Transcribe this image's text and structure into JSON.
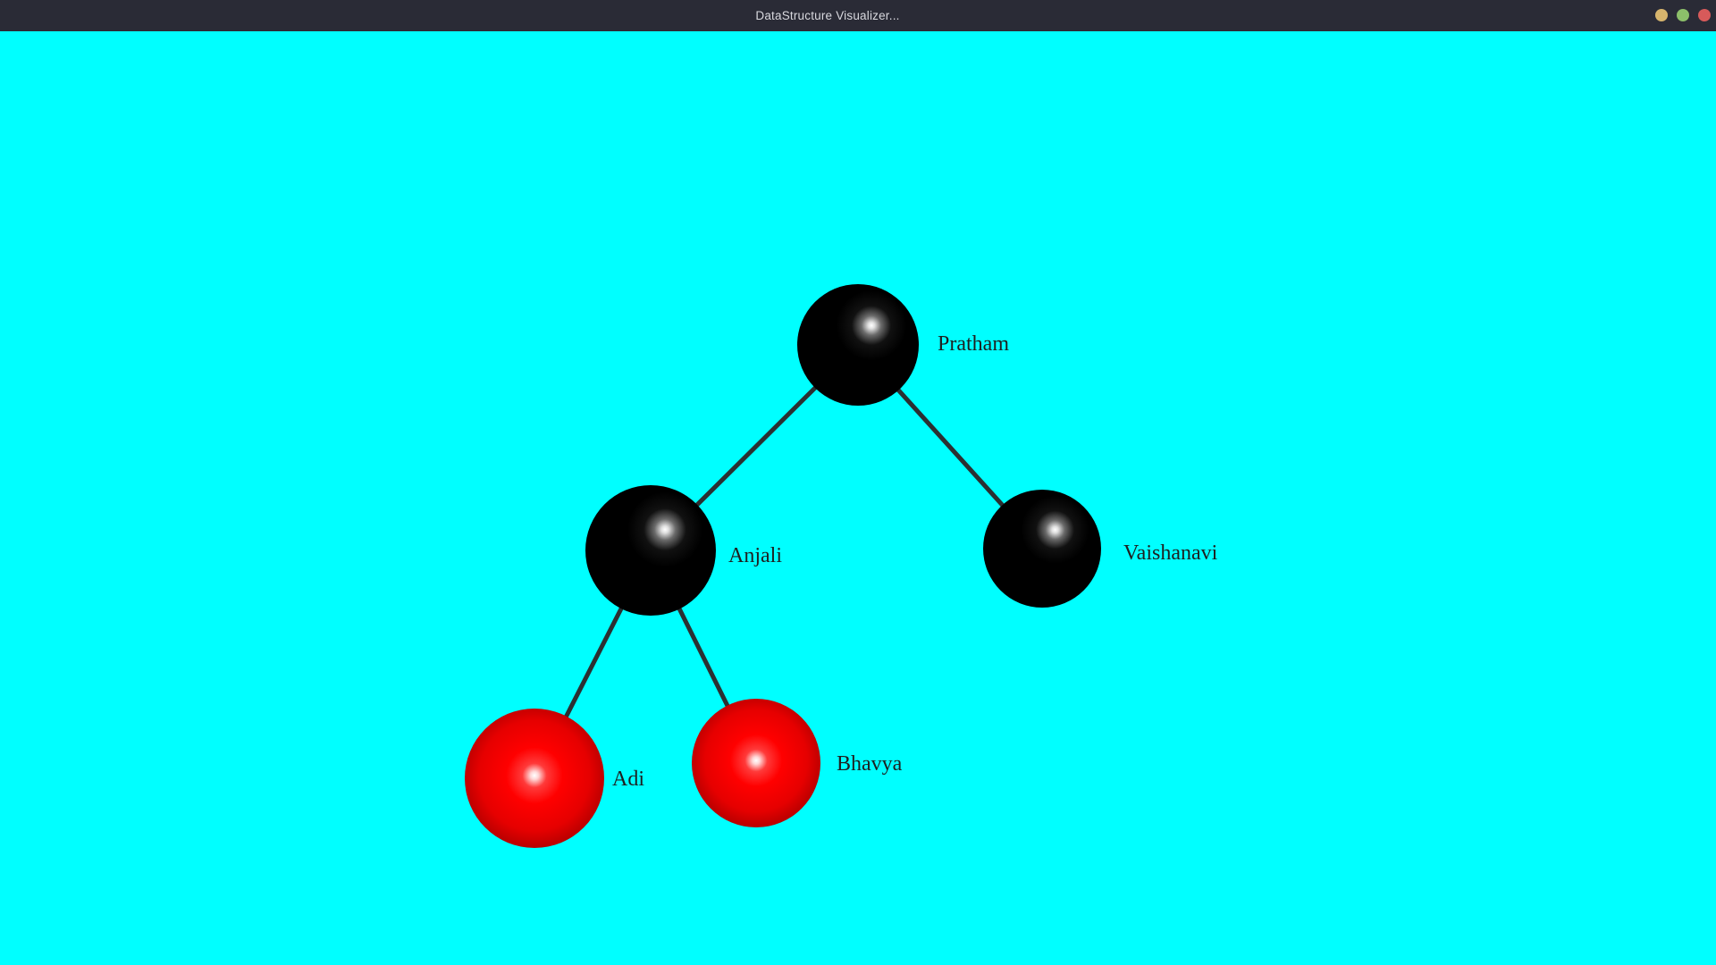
{
  "window": {
    "title": "DataStructure Visualizer...",
    "controls": [
      {
        "name": "minimize-button",
        "color": "#d7b56d"
      },
      {
        "name": "maximize-button",
        "color": "#8cbf6a"
      },
      {
        "name": "close-button",
        "color": "#d75a5a"
      }
    ]
  },
  "canvas": {
    "background": "#00FFFF"
  },
  "tree": {
    "nodes": [
      {
        "id": "pratham",
        "label": "Pratham",
        "color": "black"
      },
      {
        "id": "anjali",
        "label": "Anjali",
        "color": "black"
      },
      {
        "id": "vaishanavi",
        "label": "Vaishanavi",
        "color": "black"
      },
      {
        "id": "adi",
        "label": "Adi",
        "color": "red"
      },
      {
        "id": "bhavya",
        "label": "Bhavya",
        "color": "red"
      }
    ],
    "edges": [
      {
        "from": "pratham",
        "to": "anjali"
      },
      {
        "from": "pratham",
        "to": "vaishanavi"
      },
      {
        "from": "anjali",
        "to": "adi"
      },
      {
        "from": "anjali",
        "to": "bhavya"
      }
    ]
  }
}
